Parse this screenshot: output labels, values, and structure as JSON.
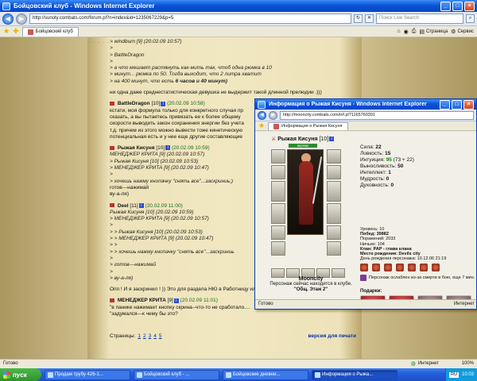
{
  "main": {
    "title": "Бойцовский клуб - Windows Internet Explorer",
    "url": "http://sunoty.combats.com/forum.pl?n=index&id=1235067229&p=5",
    "search_placeholder": "Поиск Live Search",
    "tab_label": "Бойцовский клуб",
    "cmd_page": "Страница",
    "cmd_service": "Сервис"
  },
  "posts": [
    {
      "kind": "quote",
      "lines": [
        "> windburn [9]   (20.02.09 10:57)",
        ">",
        "> BattleDragon",
        ">",
        "> а что мешает растянуть как-мить так, чтоб одна рюмка в 10",
        "> минут... рюмка по 50. Тогда выходит, что 2 литра хватит",
        "> на 400 минут, что есть "
      ]
    },
    {
      "kind": "text",
      "line": "ни одна даже среднестатистическая девушка не выдержит такой длинной прелюдии .)))"
    }
  ],
  "quote_bold_tail": "6 часов и 40 минут)",
  "post2": {
    "author": "BattleDragon",
    "level": "[10]",
    "time": "(20.02.09 10:58)",
    "lines": [
      "кстати, моя формула только для конкретного случая пр",
      "сказать, а вы пытаетесь привязать ее к более общему",
      "скорости выводить закон сохранения энергии без учета",
      "т.д. причем из этого можно вывести тоже кинетическую",
      "потенциальная есть и у нее еще другие составляющие"
    ]
  },
  "post3": {
    "author": "Рыжая Кисуня",
    "level": "[10]",
    "time": "(20.02.09 10:59)",
    "lines": [
      "МЕНЕДЖЕР КРИТА [9]   (20.02.09 10:57)",
      "",
      "> Рыжая Кисуня [10]   (20.02.09 10:53)",
      "> МЕНЕДЖЕР КРИТА [9]   (20.02.09 10:47)",
      ">",
      "> хочешь нажму кнопачку \"снять все\"...заскриниь;)",
      "",
      "готов---нажимай",
      "",
      "ву-а-ля)"
    ]
  },
  "post4": {
    "author": "Deel",
    "level": "[11]",
    "time": "(20.02.09 11:00)",
    "lines": [
      "Рыжая Кисуня [10]   (20.02.09 10:59)",
      "> МЕНЕДЖЕР КРИТА [9]   (20.02.09 10:57)",
      ">",
      "> > Рыжая Кисуня [10]   (20.02.09 10:53)",
      "> > МЕНЕДЖЕР КРИТА [9]   (20.02.09 10:47)",
      "> >",
      "> > хочешь нажму кнопачку \"снять все\"...заскриниь",
      ">",
      "> готов---нажимай",
      ">",
      "> ву-а-ля)"
    ]
  },
  "post5_line": "Опп ! И я заскринил ! )) Это для раздела НЮ в Работницу или Домашний Очаг !",
  "post6": {
    "author": "МЕНЕДЖЕР КРИТА",
    "level": "[9]",
    "time": "(20.02.09 11:01)",
    "lines": [
      "\"в панике нажимает кнопку скрина--что-то не сработало....",
      "\"задумался---к чему бы это?"
    ]
  },
  "pagination": {
    "label": "Страницы:",
    "pages": [
      "1",
      "2",
      "3",
      "4",
      "5"
    ],
    "print": "версия для печати"
  },
  "status": {
    "left": "Готово",
    "zone": "Интернет",
    "zoom": "100%"
  },
  "taskbar": {
    "start": "пуск",
    "tasks": [
      "Продам трубу 426-1...",
      "Бойцовский клуб - ...",
      "Бойцовские дневни...",
      "Информация о Рыжа..."
    ],
    "lang": "RU",
    "clock": "10:03"
  },
  "popup": {
    "title": "Информация о Рыжая Кисуня - Windows Internet Explorer",
    "url": "http://mooncity.combats.com/inf.pl?1165760391",
    "tab_label": "Информация о Рыжая Кисуня",
    "hero_name": "Рыжая Кисуня",
    "hero_level": "[10]",
    "hp": "880/880",
    "stats": [
      {
        "label": "Сила:",
        "value": "22",
        "extra": ""
      },
      {
        "label": "Ловкость:",
        "value": "15",
        "extra": ""
      },
      {
        "label": "Интуиция:",
        "value": "95",
        "extra": "(73 + 22)"
      },
      {
        "label": "Выносливость:",
        "value": "50",
        "extra": ""
      },
      {
        "label": "Интеллект:",
        "value": "1",
        "extra": ""
      },
      {
        "label": "Мудрость:",
        "value": "0",
        "extra": ""
      },
      {
        "label": "Духовность:",
        "value": "0",
        "extra": ""
      }
    ],
    "info": [
      "Уровень: 10",
      "Побед: 39882",
      "Поражений: 2033",
      "Ничьих: 104",
      "Клан: PAP - глава клана",
      "Место рождения: Devils city",
      "День рождения персонажа: 10.12.06 21:19"
    ],
    "trauma": "Персонаж ослаблен из-за смерти в бою, еще 7 мин.",
    "city_name": "Mooncity",
    "city_line1": "Персонаж сейчас находится в клубе.",
    "city_line2": "\"Общ. Этаж 2\"",
    "gifts_title": "Подарки:",
    "status_left": "Готово",
    "status_zone": "Интернет"
  }
}
